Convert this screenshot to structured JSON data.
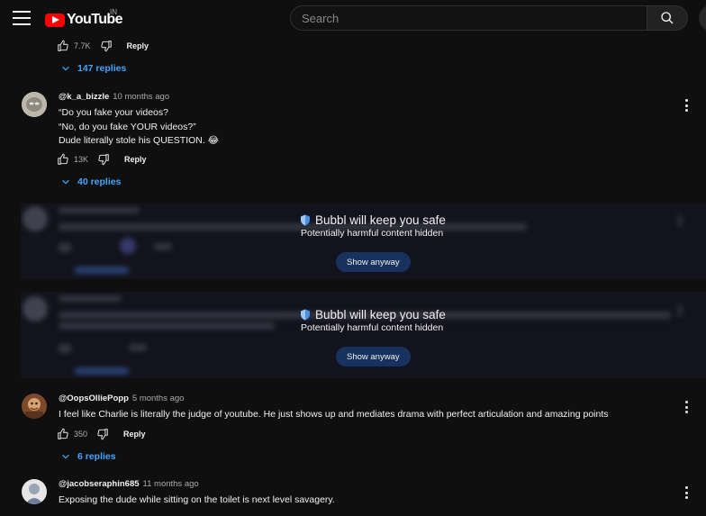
{
  "header": {
    "logo_text": "YouTube",
    "country_code": "IN",
    "search_placeholder": "Search"
  },
  "top_comment": {
    "like_count": "7.7K",
    "reply_label": "Reply",
    "replies_label": "147 replies"
  },
  "comments": [
    {
      "author": "@k_a_bizzle",
      "time": "10 months ago",
      "lines": [
        "“Do you fake your videos?",
        "“No, do you fake YOUR videos?”",
        "Dude literally stole his QUESTION. 😂"
      ],
      "like_count": "13K",
      "reply_label": "Reply",
      "replies_label": "40 replies"
    },
    {
      "author": "@OopsOlliePopp",
      "time": "5 months ago",
      "lines": [
        "I feel like Charlie is literally the judge of youtube. He just shows up and mediates drama with perfect articulation and amazing points"
      ],
      "like_count": "350",
      "reply_label": "Reply",
      "replies_label": "6 replies"
    },
    {
      "author": "@jacobseraphin685",
      "time": "11 months ago",
      "lines": [
        "Exposing the dude while sitting on the toilet is next level savagery."
      ]
    }
  ],
  "hidden_blocks": [
    {
      "title": "Bubbl will keep you safe",
      "subtitle": "Potentially harmful content hidden",
      "button": "Show anyway"
    },
    {
      "title": "Bubbl will keep you safe",
      "subtitle": "Potentially harmful content hidden",
      "button": "Show anyway"
    }
  ],
  "colors": {
    "background": "#0f0f0f",
    "link": "#3ea6ff",
    "brand_red": "#ff0000",
    "shield": "#4a90e2",
    "show_button": "#17325e"
  },
  "icons": [
    "menu-icon",
    "search-icon",
    "thumbs-up-icon",
    "thumbs-down-icon",
    "chevron-down-icon",
    "more-vert-icon",
    "shield-icon"
  ]
}
